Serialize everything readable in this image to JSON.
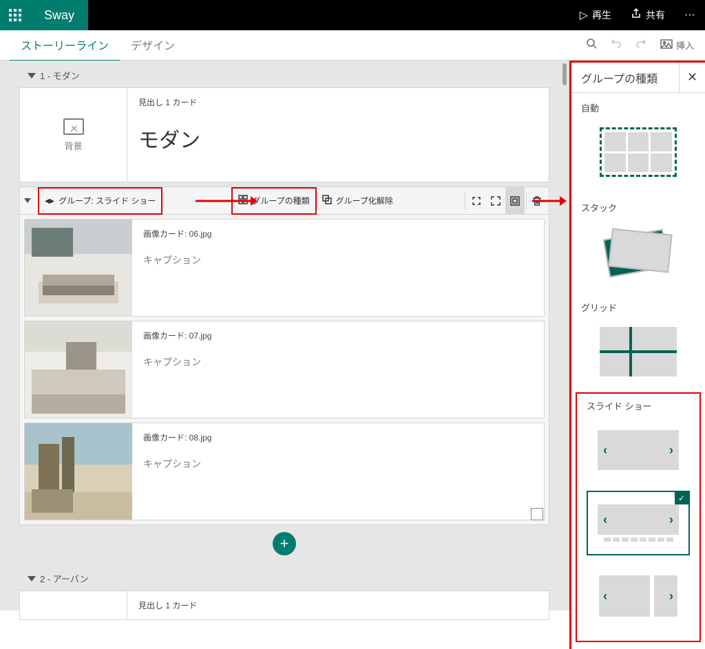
{
  "topbar": {
    "brand": "Sway",
    "play": "再生",
    "share": "共有"
  },
  "subbar": {
    "tab_storyline": "ストーリーライン",
    "tab_design": "デザイン",
    "insert": "挿入"
  },
  "storyline": {
    "section1": {
      "label": "1 - モダン"
    },
    "heading_card": {
      "label": "見出し 1 カード",
      "title": "モダン",
      "bg_label": "背景"
    },
    "group_toolbar": {
      "name": "グループ: スライド ショー",
      "type": "グループの種類",
      "ungroup": "グループ化解除"
    },
    "image_cards": [
      {
        "label": "画像カード: 06.jpg",
        "caption": "キャプション"
      },
      {
        "label": "画像カード: 07.jpg",
        "caption": "キャプション"
      },
      {
        "label": "画像カード: 08.jpg",
        "caption": "キャプション"
      }
    ],
    "section2": {
      "label": "2 - アーバン"
    },
    "heading_card2": {
      "label": "見出し 1 カード"
    }
  },
  "panel": {
    "title": "グループの種類",
    "auto": "自動",
    "stack": "スタック",
    "grid": "グリッド",
    "slideshow": "スライド ショー"
  }
}
